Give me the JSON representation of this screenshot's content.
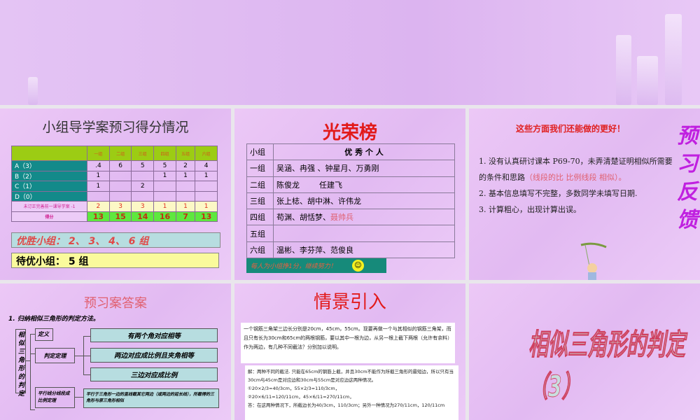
{
  "slide1": {
    "title": "小组导学案预习得分情况",
    "columns": [
      "一组",
      "二组",
      "三组",
      "四组",
      "五组",
      "六组"
    ],
    "rows": [
      {
        "label": "A（3）",
        "values": [
          ".4",
          "6",
          "5",
          "5",
          "2",
          "4"
        ]
      },
      {
        "label": "B（2）",
        "values": [
          "1",
          "",
          "",
          "1",
          "1",
          "1"
        ]
      },
      {
        "label": "C（1）",
        "values": [
          "1",
          "",
          "2",
          "",
          "",
          ""
        ]
      },
      {
        "label": "D（0）",
        "values": [
          "",
          "",
          "",
          "",
          "",
          ""
        ]
      }
    ],
    "penalty": {
      "label": "未订正完善前一课导学案 -1",
      "values": [
        "2",
        "3",
        "3",
        "1",
        "1",
        "1"
      ]
    },
    "total": {
      "label": "得分",
      "values": [
        "13",
        "15",
        "14",
        "16",
        "7",
        "13"
      ]
    },
    "winners": "优胜小组： 2、 3、 4、 6 组",
    "waiting": "待优小组： 5 组"
  },
  "slide2": {
    "title": "光荣榜",
    "header": [
      "小组",
      "优 秀 个 人"
    ],
    "rows": [
      [
        "一组",
        "吴涵、冉强 、钟星月、万勇刚",
        ""
      ],
      [
        "二组",
        "陈俊龙        任建飞",
        ""
      ],
      [
        "三组",
        "张上梽、胡中淋、许伟龙",
        ""
      ],
      [
        "四组",
        "苟渊、胡恬梦、",
        "聂帅兵"
      ],
      [
        "五组",
        "",
        ""
      ],
      [
        "六组",
        "温彬、李芬萍、范俊良",
        ""
      ]
    ],
    "note": "每人为小组挣1分，继续努力！"
  },
  "slide3": {
    "title": "这些方面我们还能做的更好！",
    "vertical": "预习反馈",
    "item1": "1. 没有认真研讨课本 P69-70，未弄清楚证明相似所需要的条件和思路",
    "item1_red": "（线段的比   比例线段   相似）。",
    "item2": "2. 基本信息填写不完整，多数同学未填写日期.",
    "item3": "3. 计算粗心，出现计算出误。"
  },
  "slide4": {
    "title": "预习案答案",
    "question": "1. 归纳相似三角形的判定方法。",
    "root": "相似三角形的判定",
    "definition": "定义",
    "theorem": "判定定理",
    "parallel": "平行线分线段成比例定理",
    "t1": "有两个角对应相等",
    "t2": "两边对应成比例且夹角相等",
    "t3": "三边对应成比例",
    "p1": "平行于三角形一边的直线截其它两边（或两边的延长线），所截得的三角形与原三角形相似"
  },
  "slide5": {
    "title": "情景引入",
    "problem": "一个钢筋三角架三边长分别是20cm，45cm，55cm。现要再做一个与其相似的钢筋三角架，而且只有长为30cm和65cm的两根钢筋，要以其中一根为边，从另一根上截下两根（允许有余料）作为两边，有几种不同截法？分别加以说明。",
    "sol1": "解：两种不同的截法. 只能在65cm的钢筋上截，并且30cm不能作为所截三角形的最短边，所以只有当30cm与45cm是对应边和30cm与55cm是对应边这两种情况。",
    "sol2": "①20×2/3=40/3cm，55×2/3=110/3cm，",
    "sol3": "②20×6/11=120/11cm，45×6/11=270/11cm，",
    "sol4": "答：在这两种情况下，所截边长为40/3cm，110/3cm；另外一种情况为270/11cm，120/11cm"
  },
  "slide6": {
    "title": "相似三角形的判定（3）"
  }
}
